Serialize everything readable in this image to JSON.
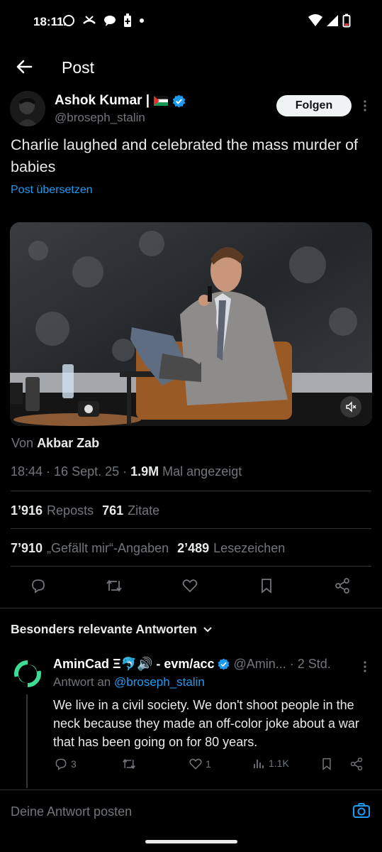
{
  "status_bar": {
    "time": "18:11",
    "icons": [
      "whatsapp-icon",
      "missed-call-icon",
      "chat-bubble-icon",
      "battery-saver-icon",
      "dot-icon",
      "wifi-icon",
      "signal-icon",
      "battery-low-icon"
    ]
  },
  "header": {
    "title": "Post",
    "back_icon": "arrow-left-icon"
  },
  "post": {
    "author_name": "Ashok Kumar |",
    "author_flag": "palestine-flag-icon",
    "verified": true,
    "handle": "@broseph_stalin",
    "follow_label": "Folgen",
    "text": "Charlie laughed and celebrated the mass murder of babies",
    "translate_label": "Post übersetzen",
    "from_prefix": "Von",
    "from_name": "Akbar Zab",
    "time": "18:44 · 16 Sept. 25 · ",
    "views_count": "1.9M",
    "views_label": " Mal angezeigt",
    "reposts_count": "1’916",
    "reposts_label": "Reposts",
    "quotes_count": "761",
    "quotes_label": "Zitate",
    "likes_count": "7’910",
    "likes_label": "„Gefällt mir“-Angaben",
    "bookmarks_count": "2’489",
    "bookmarks_label": "Lesezeichen"
  },
  "relevant_replies": {
    "label": "Besonders relevante Antworten"
  },
  "reply": {
    "name": "AminCad Ξ🐬🔊 - evm/acc",
    "handle": "@Amin...",
    "time": "· 2 Std.",
    "reply_to_prefix": "Antwort an",
    "reply_to_handle": "@broseph_stalin",
    "text": "We live in a civil society. We don't shoot people in the neck because they made an off-color joke about a war that has been going on for 80 years.",
    "replies": "3",
    "likes": "1",
    "views": "1.1K"
  },
  "compose": {
    "placeholder": "Deine Antwort posten"
  },
  "colors": {
    "accent": "#1d9bf0",
    "background": "#000000",
    "muted": "#71767b"
  }
}
